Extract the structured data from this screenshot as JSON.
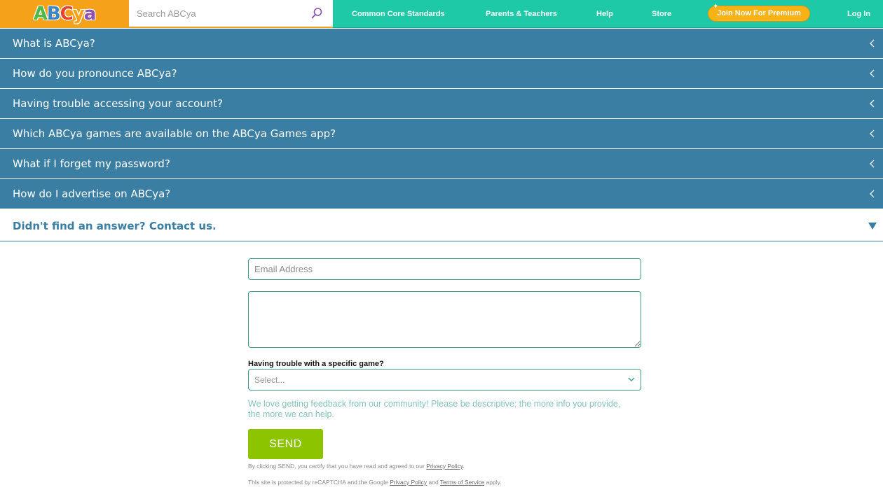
{
  "header": {
    "logo": {
      "letters": [
        "A",
        "B",
        "C",
        "y",
        "a"
      ],
      "colors": [
        "#4cb848",
        "#3a86c8",
        "#e8412c",
        "#f5a11a",
        "#8b4fb0"
      ]
    },
    "search_placeholder": "Search ABCya",
    "nav": {
      "common_core": "Common Core Standards",
      "parents_teachers": "Parents & Teachers",
      "help": "Help",
      "store": "Store",
      "premium": "Join Now For Premium",
      "login": "Log In"
    }
  },
  "faq": [
    {
      "question": "What is ABCya?"
    },
    {
      "question": "How do you pronounce ABCya?"
    },
    {
      "question": "Having trouble accessing your account?"
    },
    {
      "question": "Which ABCya games are available on the ABCya Games app?"
    },
    {
      "question": "What if I forget my password?"
    },
    {
      "question": "How do I advertise on ABCya?"
    }
  ],
  "contact": {
    "title": "Didn't find an answer? Contact us.",
    "email_placeholder": "Email Address",
    "game_label": "Having trouble with a specific game?",
    "select_placeholder": "Select...",
    "help_text": "We love getting feedback from our community! Please be descriptive; the more info you provide, the more we can help.",
    "send_label": "SEND",
    "certify_prefix": "By clicking SEND, you certify that you have read and agreed to our ",
    "certify_link": "Privacy Policy",
    "certify_suffix": ".",
    "recaptcha_prefix": "This site is protected by reCAPTCHA and the Google ",
    "recaptcha_privacy": "Privacy Policy",
    "recaptcha_and": " and ",
    "recaptcha_terms": "Terms of Service",
    "recaptcha_suffix": " apply."
  },
  "colors": {
    "nav_green": "#1ec9a7",
    "logo_orange": "#f5a11a",
    "faq_blue": "#3a7fa3",
    "send_green": "#8cc500",
    "premium_yellow": "#f7b316"
  }
}
